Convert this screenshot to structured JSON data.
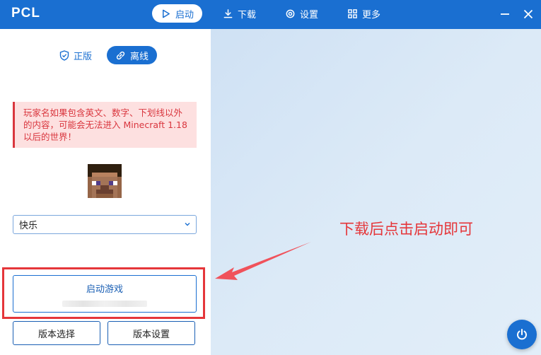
{
  "app": {
    "title": "PCL"
  },
  "nav": {
    "launch": "启动",
    "download": "下载",
    "settings": "设置",
    "more": "更多"
  },
  "colors": {
    "primary": "#1a6fd1",
    "danger": "#e5363a",
    "warning_bg": "#fde0e0"
  },
  "mode_tabs": {
    "official": "正版",
    "offline": "离线",
    "selected": "离线"
  },
  "warning": {
    "text": "玩家名如果包含英文、数字、下划线以外的内容，可能会无法进入 Minecraft 1.18 以后的世界！"
  },
  "player": {
    "selected_name": "快乐"
  },
  "launch": {
    "label": "启动游戏"
  },
  "buttons": {
    "version_select": "版本选择",
    "version_settings": "版本设置"
  },
  "annotation": {
    "text": "下载后点击启动即可"
  },
  "icons": {
    "launch": "play-icon",
    "download": "download-icon",
    "settings": "gear-icon",
    "more": "grid-icon",
    "minimize": "minimize-icon",
    "close": "close-icon",
    "official": "shield-icon",
    "offline": "link-icon",
    "dropdown": "chevron-down-icon",
    "power": "power-icon"
  }
}
